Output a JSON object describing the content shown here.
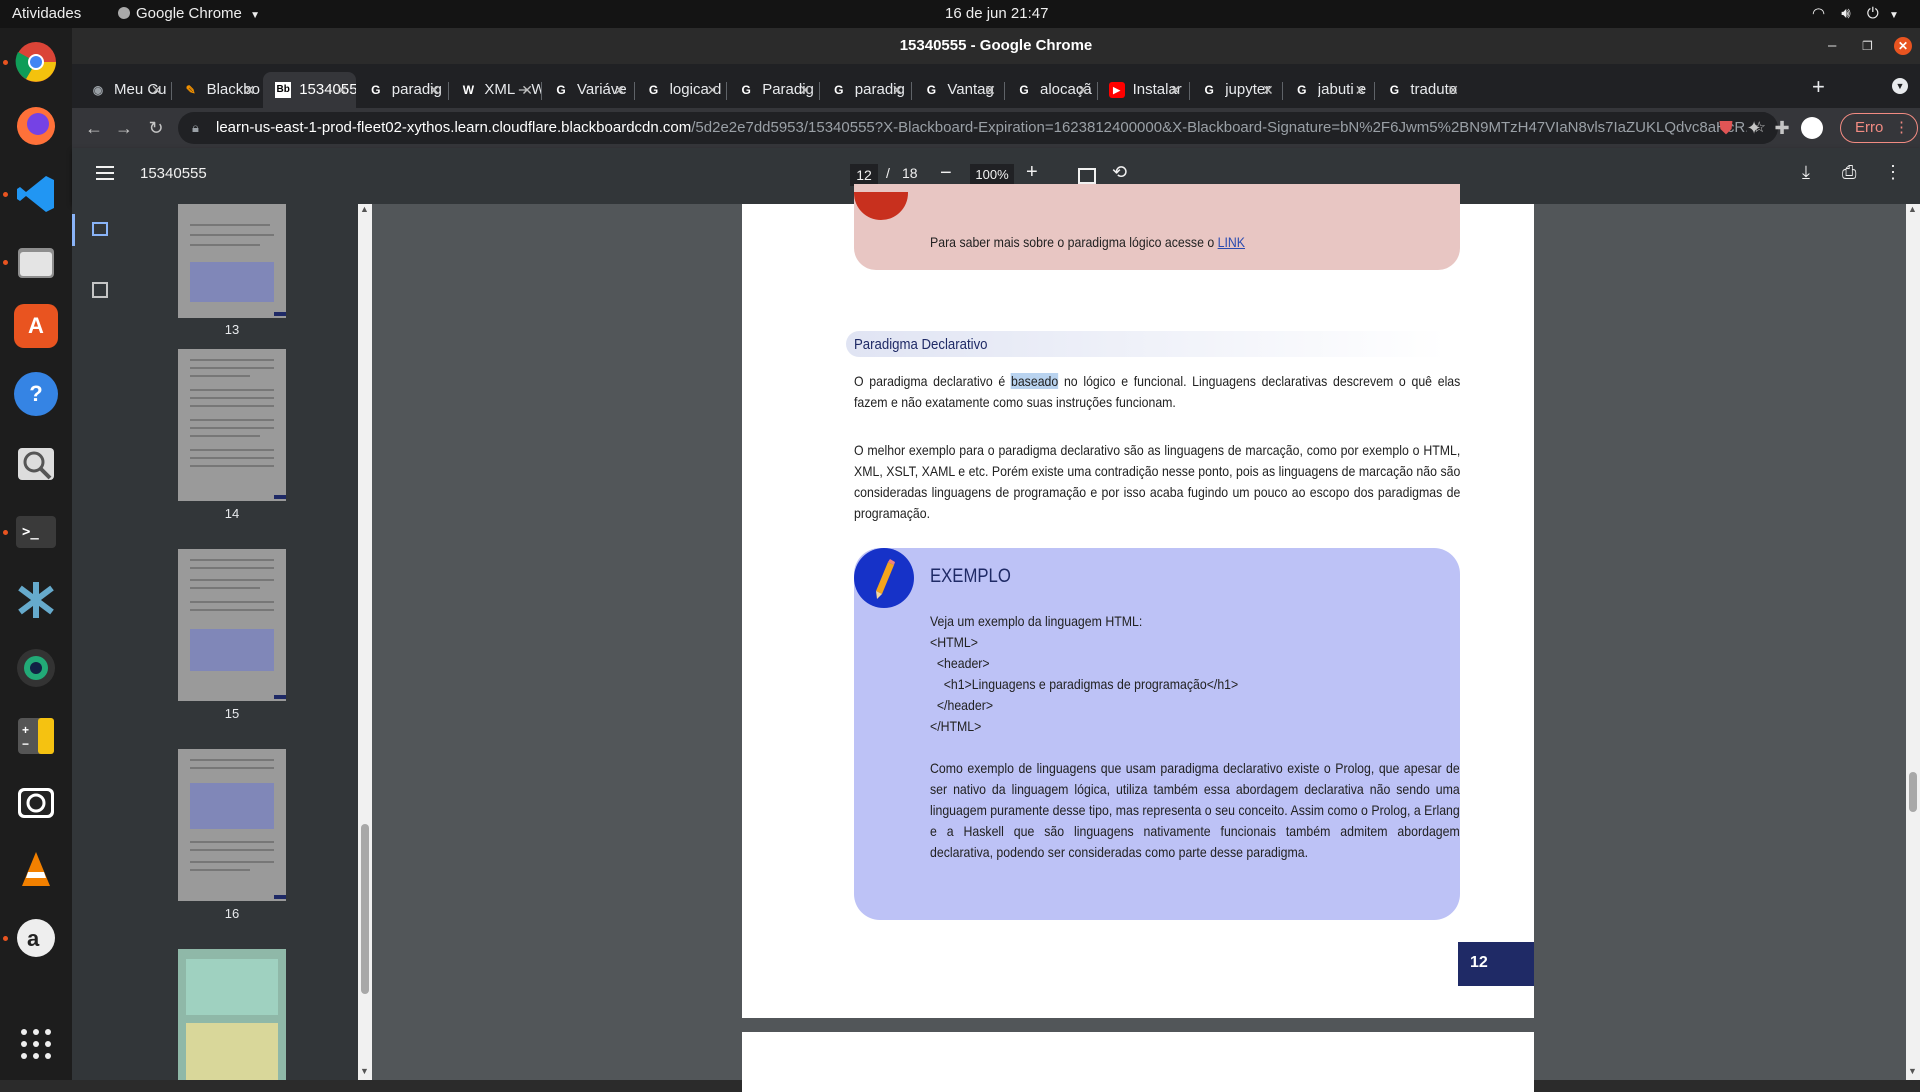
{
  "topbar": {
    "activities": "Atividades",
    "app_name": "Google Chrome",
    "datetime": "16 de jun  21:47"
  },
  "window": {
    "title": "15340555 - Google Chrome"
  },
  "tabs": [
    {
      "label": "Meu Cu",
      "favicon": "chrome-icon"
    },
    {
      "label": "Blackbo",
      "favicon": "blackboard-icon"
    },
    {
      "label": "15340555",
      "favicon": "bb-icon",
      "active": true
    },
    {
      "label": "paradig",
      "favicon": "google-icon"
    },
    {
      "label": "XML – W",
      "favicon": "wikipedia-icon"
    },
    {
      "label": "Variáve",
      "favicon": "google-icon"
    },
    {
      "label": "logica d",
      "favicon": "google-icon"
    },
    {
      "label": "Paradig",
      "favicon": "google-icon"
    },
    {
      "label": "paradig",
      "favicon": "google-icon"
    },
    {
      "label": "Vantag",
      "favicon": "google-icon"
    },
    {
      "label": "alocaçã",
      "favicon": "google-icon"
    },
    {
      "label": "Instalar",
      "favicon": "youtube-icon"
    },
    {
      "label": "jupyter",
      "favicon": "google-icon"
    },
    {
      "label": "jabuti e",
      "favicon": "google-icon"
    },
    {
      "label": "traduto",
      "favicon": "google-icon"
    }
  ],
  "address_bar": {
    "host": "learn-us-east-1-prod-fleet02-xythos.learn.cloudflare.blackboardcdn.com",
    "path": "/5d2e2e7dd5953/15340555?X-Blackboard-Expiration=1623812400000&X-Blackboard-Signature=bN%2F6Jwm5%2BN9MTzH47VIaN8vls7IaZUKLQdvc8aHcR..."
  },
  "profile_error": "Erro",
  "pdf_toolbar": {
    "doc_title": "15340555",
    "current_page": "12",
    "page_sep": "/",
    "total_pages": "18",
    "zoom": "100%"
  },
  "thumbnails": [
    {
      "page": "13"
    },
    {
      "page": "14"
    },
    {
      "page": "15"
    },
    {
      "page": "16"
    }
  ],
  "pdf_page": {
    "link_box_text": "Para saber mais sobre o paradigma lógico acesse o ",
    "link_text": "LINK",
    "section_heading": "Paradigma Declarativo",
    "p1_before": "O paradigma declarativo é ",
    "p1_highlight": "baseado",
    "p1_after": " no lógico e funcional. Linguagens declarativas descrevem o quê elas fazem e não exatamente como suas instruções funcionam.",
    "p2": "O melhor exemplo para o paradigma declarativo são as linguagens de marcação, como por exemplo o HTML, XML, XSLT, XAML e etc. Porém existe uma contradição nesse ponto, pois as linguagens de marcação não são consideradas linguagens de programação e por isso acaba fugindo um pouco ao escopo dos paradigmas de programação.",
    "example_title": "EXEMPLO",
    "example_intro": "Veja um exemplo da linguagem HTML:",
    "code_lines": [
      "<HTML>",
      "  <header>",
      "    <h1>Linguagens e paradigmas de programação</h1>",
      "  </header>",
      "</HTML>"
    ],
    "example_p": "Como exemplo de linguagens que usam paradigma declarativo existe o Prolog, que apesar de ser nativo da linguagem lógica, utiliza também essa abordagem declarativa não sendo uma linguagem puramente desse tipo, mas representa o seu conceito. Assim como o Prolog, a Erlang e a Haskell que são linguagens nativamente funcionais também admitem abordagem declarativa, podendo ser consideradas como parte desse paradigma.",
    "page_number": "12"
  },
  "colors": {
    "link_box_bg": "#e8c6c3",
    "example_box_bg": "#bdc2f6",
    "example_icon_bg": "#1632c8",
    "page_number_bg": "#1f2a66",
    "heading_bg": "#e9ecf6",
    "highlight": "#b9d3ef"
  }
}
